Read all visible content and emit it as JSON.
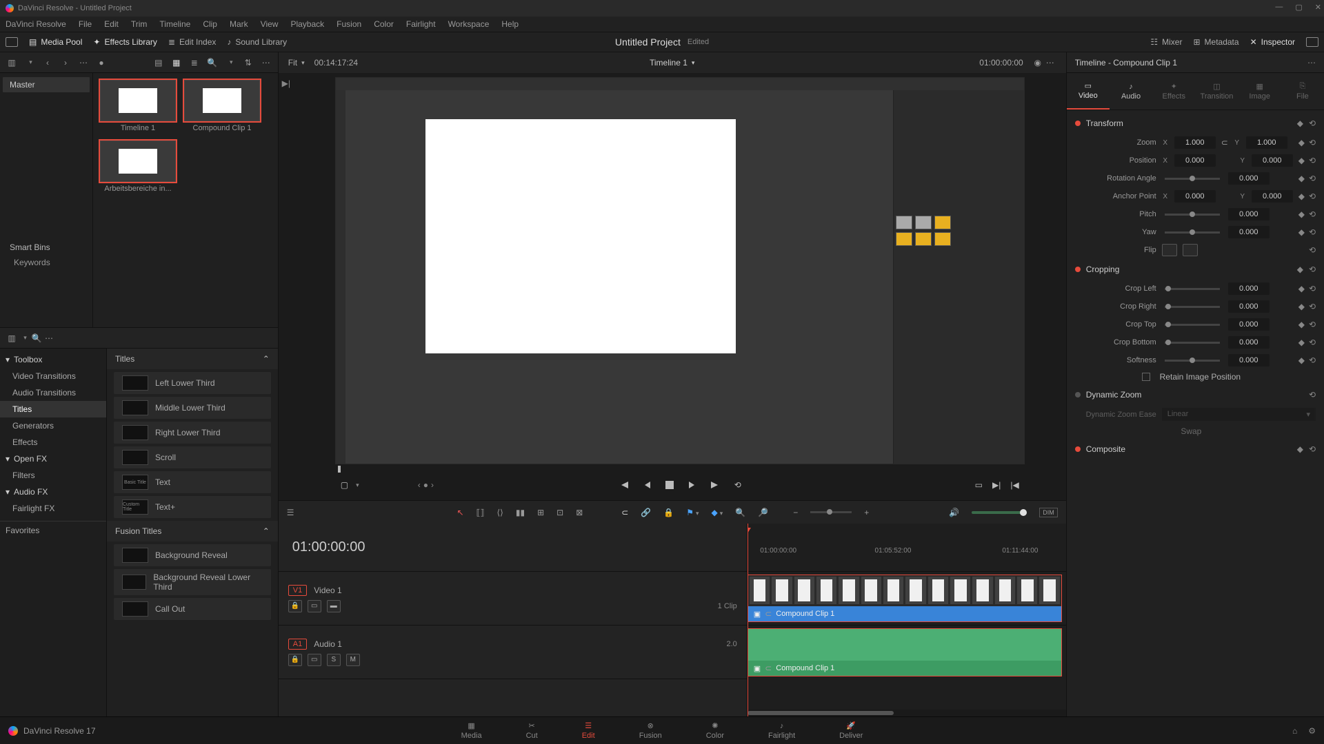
{
  "app": {
    "title": "DaVinci Resolve - Untitled Project",
    "footer": "DaVinci Resolve 17"
  },
  "menu": [
    "DaVinci Resolve",
    "File",
    "Edit",
    "Trim",
    "Timeline",
    "Clip",
    "Mark",
    "View",
    "Playback",
    "Fusion",
    "Color",
    "Fairlight",
    "Workspace",
    "Help"
  ],
  "topbar": {
    "media_pool": "Media Pool",
    "effects_lib": "Effects Library",
    "edit_index": "Edit Index",
    "sound_lib": "Sound Library",
    "mixer": "Mixer",
    "metadata": "Metadata",
    "inspector": "Inspector",
    "project_title": "Untitled Project",
    "edited": "Edited"
  },
  "pool": {
    "bins": {
      "master": "Master",
      "smart": "Smart Bins",
      "keywords": "Keywords"
    },
    "clips": [
      {
        "label": "Timeline 1",
        "sel": true
      },
      {
        "label": "Compound Clip 1",
        "sel": true
      },
      {
        "label": "Arbeitsbereiche in...",
        "sel": true
      }
    ]
  },
  "viewer": {
    "fit": "Fit",
    "src_tc": "00:14:17:24",
    "timeline_name": "Timeline 1",
    "duration": "01:00:00:00"
  },
  "fx": {
    "tree": [
      {
        "label": "Toolbox",
        "h": true
      },
      {
        "label": "Video Transitions"
      },
      {
        "label": "Audio Transitions"
      },
      {
        "label": "Titles",
        "sel": true
      },
      {
        "label": "Generators"
      },
      {
        "label": "Effects"
      },
      {
        "label": "Open FX",
        "h": true
      },
      {
        "label": "Filters"
      },
      {
        "label": "Audio FX",
        "h": true
      },
      {
        "label": "Fairlight FX"
      }
    ],
    "favorites": "Favorites",
    "section1": "Titles",
    "items1": [
      {
        "sw": "",
        "label": "Left Lower Third"
      },
      {
        "sw": "",
        "label": "Middle Lower Third"
      },
      {
        "sw": "",
        "label": "Right Lower Third"
      },
      {
        "sw": "",
        "label": "Scroll"
      },
      {
        "sw": "Basic Title",
        "label": "Text"
      },
      {
        "sw": "Custom Title",
        "label": "Text+"
      }
    ],
    "section2": "Fusion Titles",
    "items2": [
      {
        "sw": "",
        "label": "Background Reveal"
      },
      {
        "sw": "",
        "label": "Background Reveal Lower Third"
      },
      {
        "sw": "",
        "label": "Call Out"
      }
    ]
  },
  "timeline": {
    "big_tc": "01:00:00:00",
    "ruler": [
      {
        "pos": 4,
        "t": "01:00:00:00"
      },
      {
        "pos": 40,
        "t": "01:05:52:00"
      },
      {
        "pos": 80,
        "t": "01:11:44:00"
      }
    ],
    "video": {
      "badge": "V1",
      "name": "Video 1",
      "clips_label": "1 Clip"
    },
    "audio": {
      "badge": "A1",
      "name": "Audio 1",
      "level": "2.0",
      "btns": [
        "S",
        "M"
      ]
    },
    "clip_name": "Compound Clip 1"
  },
  "inspector": {
    "title": "Timeline - Compound Clip 1",
    "tabs": [
      "Video",
      "Audio",
      "Effects",
      "Transition",
      "Image",
      "File"
    ],
    "transform": {
      "title": "Transform",
      "zoom": {
        "label": "Zoom",
        "x": "1.000",
        "y": "1.000"
      },
      "position": {
        "label": "Position",
        "x": "0.000",
        "y": "0.000"
      },
      "rotation": {
        "label": "Rotation Angle",
        "v": "0.000"
      },
      "anchor": {
        "label": "Anchor Point",
        "x": "0.000",
        "y": "0.000"
      },
      "pitch": {
        "label": "Pitch",
        "v": "0.000"
      },
      "yaw": {
        "label": "Yaw",
        "v": "0.000"
      },
      "flip": {
        "label": "Flip"
      }
    },
    "cropping": {
      "title": "Cropping",
      "left": {
        "label": "Crop Left",
        "v": "0.000"
      },
      "right": {
        "label": "Crop Right",
        "v": "0.000"
      },
      "top": {
        "label": "Crop Top",
        "v": "0.000"
      },
      "bottom": {
        "label": "Crop Bottom",
        "v": "0.000"
      },
      "soft": {
        "label": "Softness",
        "v": "0.000"
      },
      "retain": "Retain Image Position"
    },
    "dynzoom": {
      "title": "Dynamic Zoom",
      "ease": "Dynamic Zoom Ease",
      "ease_v": "Linear",
      "swap": "Swap"
    },
    "composite": {
      "title": "Composite"
    }
  },
  "pages": [
    "Media",
    "Cut",
    "Edit",
    "Fusion",
    "Color",
    "Fairlight",
    "Deliver"
  ]
}
